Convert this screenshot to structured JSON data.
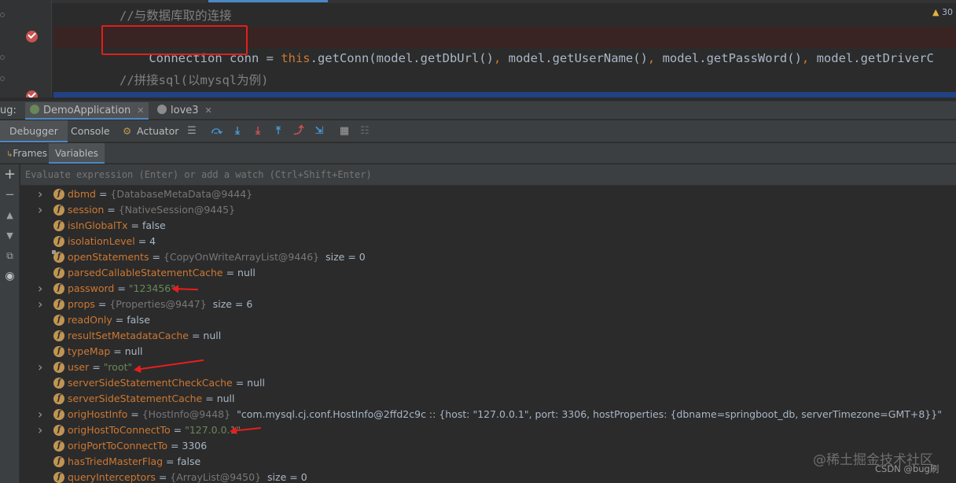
{
  "editor": {
    "comment1": "//与数据库取的连接",
    "line2": {
      "part1": "Connection conn",
      "part2": " = ",
      "kw_this": "this",
      "part3": ".getConn(model.getDbUrl()",
      "sep": ", ",
      "part4": "model.getUserName()",
      "part5": "model.getPassWord()",
      "part6": "model.getDriverC"
    },
    "comment2": "//拼接sql(以mysql为例)",
    "warning_count": "30"
  },
  "debug": {
    "label": "ug:",
    "tabs": [
      {
        "label": "DemoApplication"
      },
      {
        "label": "love3"
      }
    ]
  },
  "toolbar": {
    "tabs": [
      "Debugger",
      "Console",
      "Actuator"
    ]
  },
  "subtabs": [
    "Frames",
    "Variables"
  ],
  "eval": {
    "placeholder": "Evaluate expression (Enter) or add a watch (Ctrl+Shift+Enter)"
  },
  "variables": [
    {
      "expandable": true,
      "name": "dbmd",
      "value": "{DatabaseMetaData@9444}",
      "kind": "obj"
    },
    {
      "expandable": true,
      "name": "session",
      "value": "{NativeSession@9445}",
      "kind": "obj"
    },
    {
      "expandable": false,
      "name": "isInGlobalTx",
      "value": "false",
      "kind": "val"
    },
    {
      "expandable": false,
      "name": "isolationLevel",
      "value": "4",
      "kind": "val"
    },
    {
      "expandable": false,
      "name": "openStatements",
      "value": "{CopyOnWriteArrayList@9446}",
      "kind": "obj",
      "extra": "size = 0",
      "lock": true
    },
    {
      "expandable": false,
      "name": "parsedCallableStatementCache",
      "value": "null",
      "kind": "val"
    },
    {
      "expandable": true,
      "name": "password",
      "value": "\"123456\"",
      "kind": "str"
    },
    {
      "expandable": true,
      "name": "props",
      "value": "{Properties@9447}",
      "kind": "obj",
      "extra": "size = 6"
    },
    {
      "expandable": false,
      "name": "readOnly",
      "value": "false",
      "kind": "val"
    },
    {
      "expandable": false,
      "name": "resultSetMetadataCache",
      "value": "null",
      "kind": "val"
    },
    {
      "expandable": false,
      "name": "typeMap",
      "value": "null",
      "kind": "val"
    },
    {
      "expandable": true,
      "name": "user",
      "value": "\"root\"",
      "kind": "str"
    },
    {
      "expandable": false,
      "name": "serverSideStatementCheckCache",
      "value": "null",
      "kind": "val"
    },
    {
      "expandable": false,
      "name": "serverSideStatementCache",
      "value": "null",
      "kind": "val"
    },
    {
      "expandable": true,
      "name": "origHostInfo",
      "value": "{HostInfo@9448}",
      "kind": "obj",
      "extra": "\"com.mysql.cj.conf.HostInfo@2ffd2c9c :: {host: \"127.0.0.1\", port: 3306, hostProperties: {dbname=springboot_db, serverTimezone=GMT+8}}\""
    },
    {
      "expandable": true,
      "name": "origHostToConnectTo",
      "value": "\"127.0.0.1\"",
      "kind": "str"
    },
    {
      "expandable": false,
      "name": "origPortToConnectTo",
      "value": "3306",
      "kind": "val"
    },
    {
      "expandable": false,
      "name": "hasTriedMasterFlag",
      "value": "false",
      "kind": "val"
    },
    {
      "expandable": false,
      "name": "queryInterceptors",
      "value": "{ArrayList@9450}",
      "kind": "obj",
      "extra": "size = 0"
    }
  ],
  "watermark": {
    "main": "@稀土掘金技术社区",
    "sub": "CSDN @bug刷"
  },
  "colors": {
    "highlight_box": "#e0201a",
    "annotation_arrow": "#e81e1e",
    "accent": "#4a88c7"
  }
}
